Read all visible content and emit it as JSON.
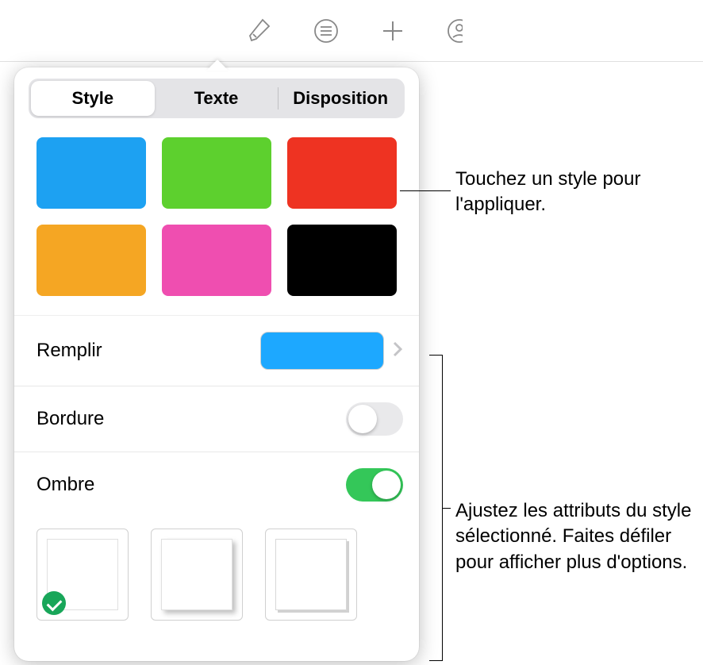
{
  "toolbar": {
    "icons": [
      "format-brush-icon",
      "list-icon",
      "add-icon",
      "collaborate-icon"
    ]
  },
  "tabs": {
    "items": [
      {
        "label": "Style",
        "active": true
      },
      {
        "label": "Texte",
        "active": false
      },
      {
        "label": "Disposition",
        "active": false
      }
    ]
  },
  "swatches": [
    {
      "color": "#1da1f2",
      "name": "blue"
    },
    {
      "color": "#5dd02e",
      "name": "green"
    },
    {
      "color": "#ee3322",
      "name": "red"
    },
    {
      "color": "#f5a623",
      "name": "orange"
    },
    {
      "color": "#ef4eb0",
      "name": "pink"
    },
    {
      "color": "#000000",
      "name": "black"
    }
  ],
  "settings": {
    "fill_label": "Remplir",
    "fill_color": "#1da8ff",
    "border_label": "Bordure",
    "border_on": false,
    "shadow_label": "Ombre",
    "shadow_on": true,
    "shadow_selected": 0
  },
  "callouts": {
    "styles": "Touchez un style pour l'appliquer.",
    "attributes": "Ajustez les attributs du style sélectionné. Faites défiler pour afficher plus d'options."
  }
}
